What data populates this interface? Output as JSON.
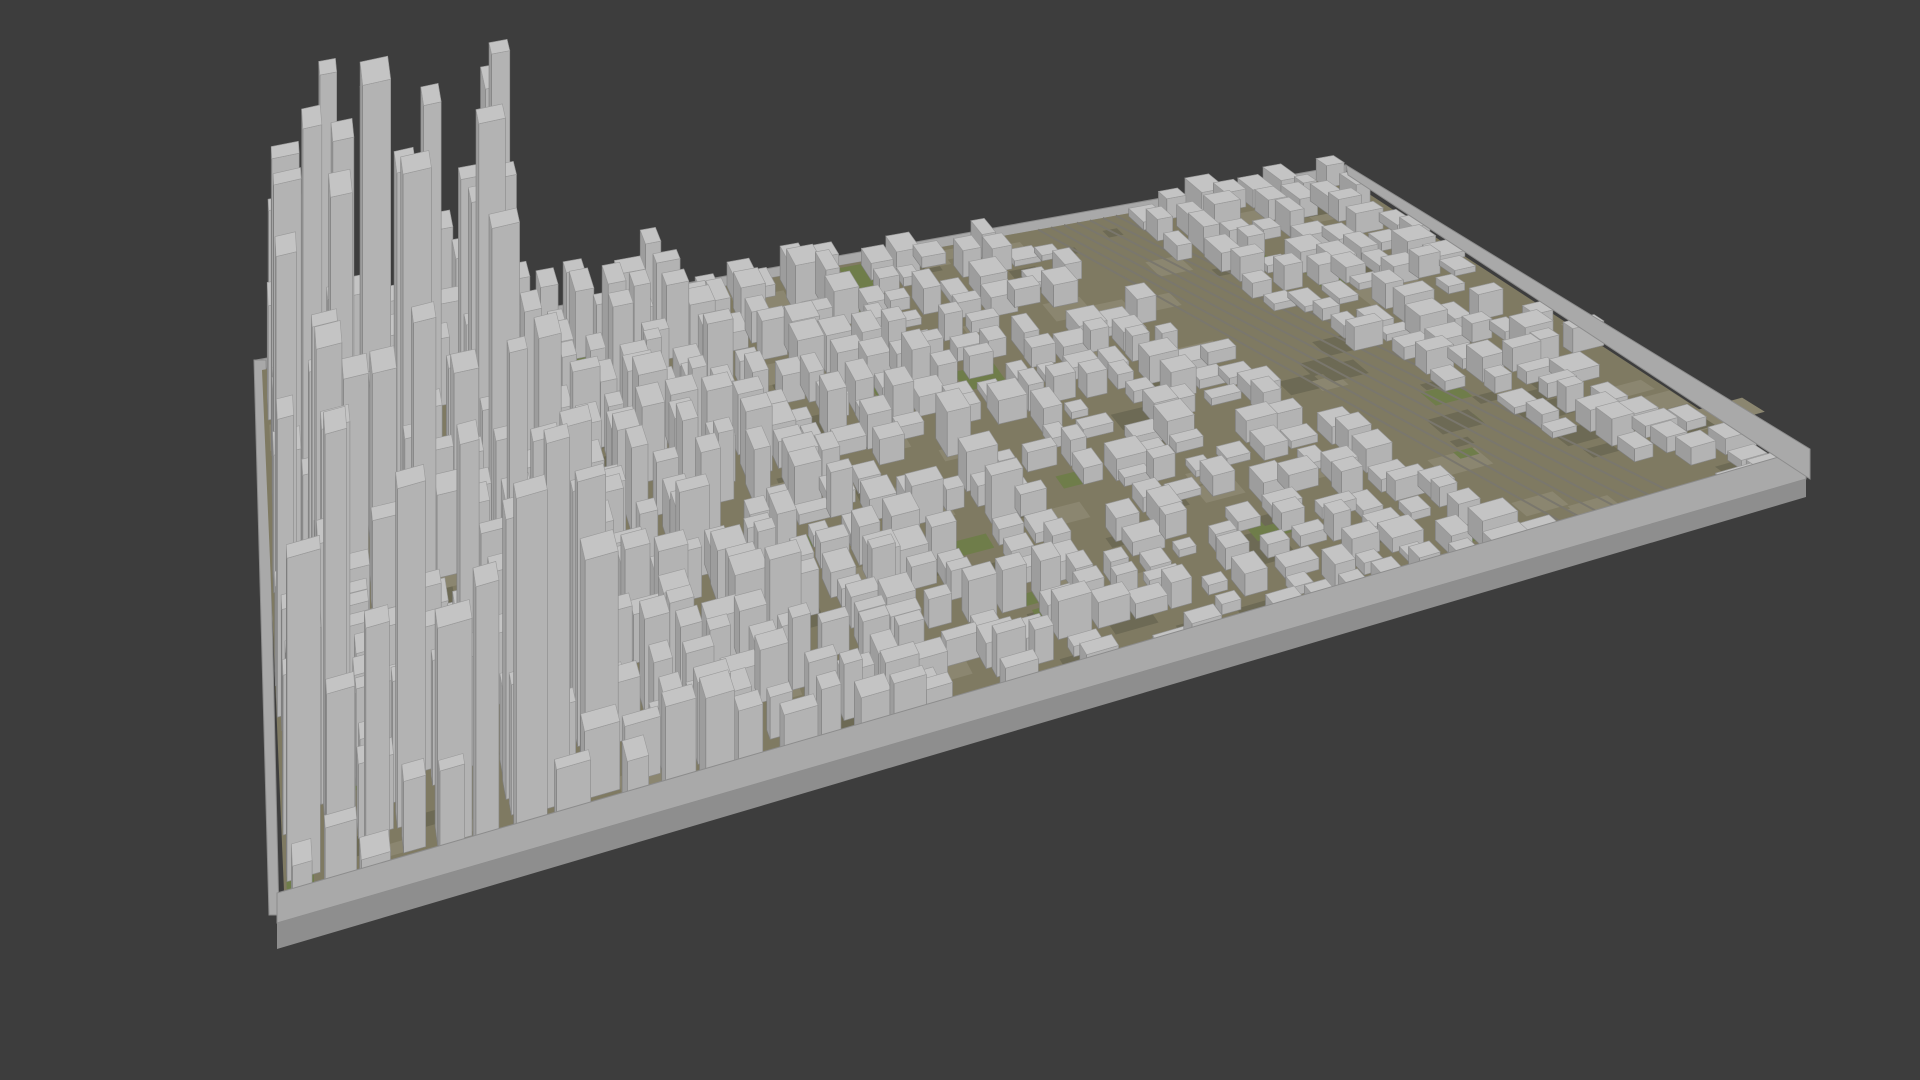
{
  "viewport": {
    "background_color": "#3d3d3d",
    "content": "3d-city-block-model",
    "colors": {
      "frame_top": "#a9a9a9",
      "frame_front": "#8e8e8e",
      "frame_side": "#7c7c7c",
      "ground": "#7f7a62",
      "ground_detail": "#6d6a55",
      "building_top": "#c4c4c4",
      "building_left": "#9d9d9d",
      "building_right": "#b3b3b3",
      "vegetation": "#6f7d4a",
      "rail": "#7a776d",
      "accent_red": "#a05a52"
    }
  }
}
